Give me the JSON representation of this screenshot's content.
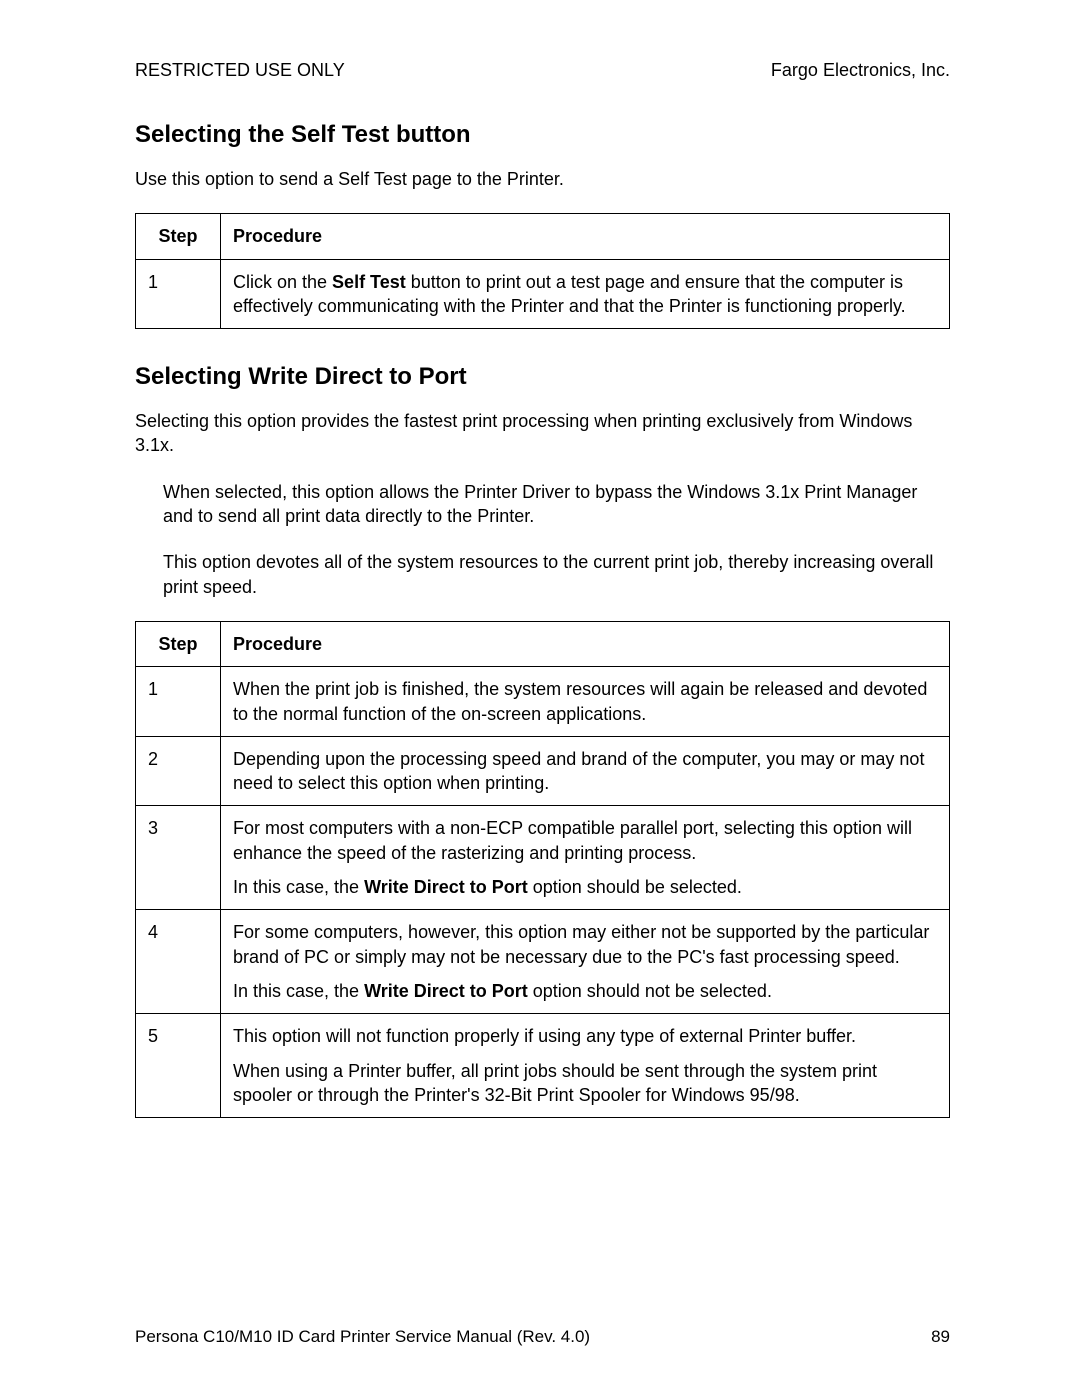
{
  "header": {
    "left": "RESTRICTED USE ONLY",
    "right": "Fargo Electronics, Inc."
  },
  "section1": {
    "title": "Selecting the Self Test button",
    "intro": "Use this option to send a Self Test page to the Printer.",
    "table": {
      "head_step": "Step",
      "head_proc": "Procedure",
      "row1_step": "1",
      "row1_a": "Click on the ",
      "row1_bold": "Self Test",
      "row1_b": " button to print out a test page and ensure that the computer is effectively communicating with the Printer and that the Printer is functioning properly."
    }
  },
  "section2": {
    "title": "Selecting Write Direct to Port",
    "intro": "Selecting this option provides the fastest print processing when printing exclusively from Windows 3.1x.",
    "indent1": "When selected, this option allows the Printer Driver to bypass the Windows 3.1x Print Manager and to send all print data directly to the Printer.",
    "indent2": "This option devotes all of the system resources to the current print job, thereby increasing overall print speed.",
    "table": {
      "head_step": "Step",
      "head_proc": "Procedure",
      "r1_step": "1",
      "r1": "When the print job is finished, the system resources will again be released and devoted to the normal function of the on-screen applications.",
      "r2_step": "2",
      "r2": "Depending upon the processing speed and brand of the computer, you may or may not need to select this option when printing.",
      "r3_step": "3",
      "r3_p1": "For most computers with a non-ECP compatible parallel port, selecting this option will enhance the speed of the rasterizing and printing process.",
      "r3_p2a": "In this case, the ",
      "r3_p2bold": "Write Direct to Port",
      "r3_p2b": " option should be selected.",
      "r4_step": "4",
      "r4_p1": "For some computers, however, this option may either not be supported by the particular brand of PC or simply may not be necessary due to the PC's fast processing speed.",
      "r4_p2a": "In this case, the ",
      "r4_p2bold": "Write Direct to Port",
      "r4_p2b": " option should not be selected.",
      "r5_step": "5",
      "r5_p1": "This option will not function properly if using any type of external Printer buffer.",
      "r5_p2": "When using a Printer buffer, all print jobs should be sent through the system print spooler or through the Printer's 32-Bit Print Spooler for Windows 95/98."
    }
  },
  "footer": {
    "left": "Persona C10/M10 ID Card Printer Service Manual (Rev. 4.0)",
    "page": "89"
  }
}
